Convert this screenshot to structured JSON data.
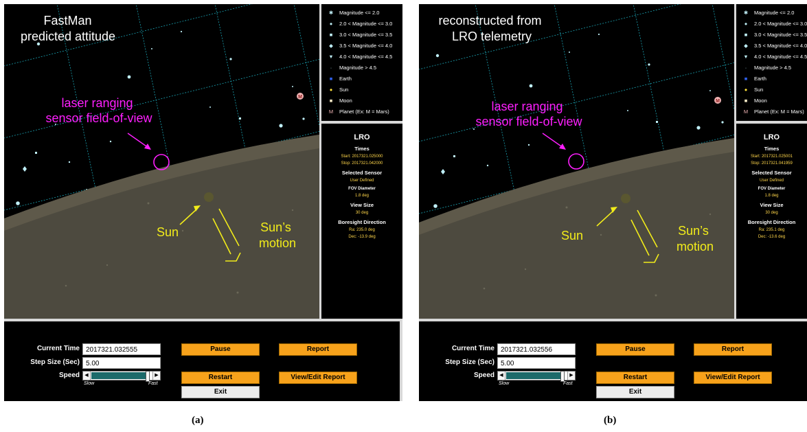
{
  "panels": [
    {
      "overlay_title": [
        "FastMan",
        "predicted attitude"
      ],
      "fov_label": [
        "laser ranging",
        "sensor field-of-view"
      ],
      "sun_label": "Sun",
      "motion_label": [
        "Sun’s",
        "motion"
      ],
      "legend": [
        {
          "symbol": "✱",
          "icon": "asterisk-star-icon",
          "color": "#bfeff7",
          "text": "Magnitude <= 2.0"
        },
        {
          "symbol": "●",
          "icon": "circle-star-icon",
          "color": "#bfeff7",
          "text": "2.0 < Magnitude <= 3.0"
        },
        {
          "symbol": "■",
          "icon": "square-star-icon",
          "color": "#bfeff7",
          "text": "3.0 < Magnitude <= 3.5"
        },
        {
          "symbol": "◆",
          "icon": "diamond-star-icon",
          "color": "#bfeff7",
          "text": "3.5 < Magnitude <= 4.0"
        },
        {
          "symbol": "▼",
          "icon": "triangle-star-icon",
          "color": "#bfeff7",
          "text": "4.0 < Magnitude <= 4.5"
        },
        {
          "symbol": "·",
          "icon": "dot-star-icon",
          "color": "#bfeff7",
          "text": "Magnitude > 4.5"
        },
        {
          "symbol": "■",
          "icon": "earth-icon",
          "color": "#2f5fe8",
          "text": "Earth"
        },
        {
          "symbol": "●",
          "icon": "sun-icon",
          "color": "#ffe23a",
          "text": "Sun"
        },
        {
          "symbol": "■",
          "icon": "moon-icon",
          "color": "#f3e7c4",
          "text": "Moon"
        },
        {
          "symbol": "M",
          "icon": "planet-icon",
          "color": "#f0b4b4",
          "text": "Planet (Ex: M = Mars)"
        }
      ],
      "info": {
        "title": "LRO",
        "times_heading": "Times",
        "start": "Start: 2017321.025000",
        "stop": "Stop: 2017321.042000",
        "sensor_heading": "Selected Sensor",
        "sensor_value": "User Defined",
        "fov_heading": "FOV Diameter",
        "fov_value": "1.8 deg",
        "view_heading": "View Size",
        "view_value": "30 deg",
        "boresight_heading": "Boresight Direction",
        "ra": "Ra: 235.0 deg",
        "dec": "Dec: -13.9 deg"
      },
      "controls": {
        "current_time_label": "Current Time",
        "current_time_value": "2017321.032555",
        "step_label": "Step Size (Sec)",
        "step_value": "5.00",
        "speed_label": "Speed",
        "slow": "Slow",
        "fast": "Fast",
        "speed_level": 0.93,
        "pause": "Pause",
        "report": "Report",
        "restart": "Restart",
        "view_edit_report": "View/Edit Report",
        "exit": "Exit"
      },
      "caption": "(a)"
    },
    {
      "overlay_title": [
        "reconstructed from",
        "LRO telemetry"
      ],
      "fov_label": [
        "laser ranging",
        "sensor field-of-view"
      ],
      "sun_label": "Sun",
      "motion_label": [
        "Sun’s",
        "motion"
      ],
      "legend": [
        {
          "symbol": "✱",
          "icon": "asterisk-star-icon",
          "color": "#bfeff7",
          "text": "Magnitude <= 2.0"
        },
        {
          "symbol": "●",
          "icon": "circle-star-icon",
          "color": "#bfeff7",
          "text": "2.0 < Magnitude <= 3.0"
        },
        {
          "symbol": "■",
          "icon": "square-star-icon",
          "color": "#bfeff7",
          "text": "3.0 < Magnitude <= 3.5"
        },
        {
          "symbol": "◆",
          "icon": "diamond-star-icon",
          "color": "#bfeff7",
          "text": "3.5 < Magnitude <= 4.0"
        },
        {
          "symbol": "▼",
          "icon": "triangle-star-icon",
          "color": "#bfeff7",
          "text": "4.0 < Magnitude <= 4.5"
        },
        {
          "symbol": "·",
          "icon": "dot-star-icon",
          "color": "#bfeff7",
          "text": "Magnitude > 4.5"
        },
        {
          "symbol": "■",
          "icon": "earth-icon",
          "color": "#2f5fe8",
          "text": "Earth"
        },
        {
          "symbol": "●",
          "icon": "sun-icon",
          "color": "#ffe23a",
          "text": "Sun"
        },
        {
          "symbol": "■",
          "icon": "moon-icon",
          "color": "#f3e7c4",
          "text": "Moon"
        },
        {
          "symbol": "M",
          "icon": "planet-icon",
          "color": "#f0b4b4",
          "text": "Planet (Ex: M = Mars)"
        }
      ],
      "info": {
        "title": "LRO",
        "times_heading": "Times",
        "start": "Start: 2017321.025001",
        "stop": "Stop: 2017321.041959",
        "sensor_heading": "Selected Sensor",
        "sensor_value": "User Defined",
        "fov_heading": "FOV Diameter",
        "fov_value": "1.8 deg",
        "view_heading": "View Size",
        "view_value": "30 deg",
        "boresight_heading": "Boresight Direction",
        "ra": "Ra: 235.1 deg",
        "dec": "Dec: -13.6 deg"
      },
      "controls": {
        "current_time_label": "Current Time",
        "current_time_value": "2017321.032556",
        "step_label": "Step Size (Sec)",
        "step_value": "5.00",
        "speed_label": "Speed",
        "slow": "Slow",
        "fast": "Fast",
        "speed_level": 0.93,
        "pause": "Pause",
        "report": "Report",
        "restart": "Restart",
        "view_edit_report": "View/Edit Report",
        "exit": "Exit"
      },
      "caption": "(b)"
    }
  ],
  "colors": {
    "annotation_magenta": "#ff1fff",
    "annotation_yellow": "#f2ec1a",
    "star": "#bfeff7",
    "grid": "#1aa3b3",
    "moon_surface": "#4d4a3f",
    "button_orange": "#f7a21b"
  }
}
